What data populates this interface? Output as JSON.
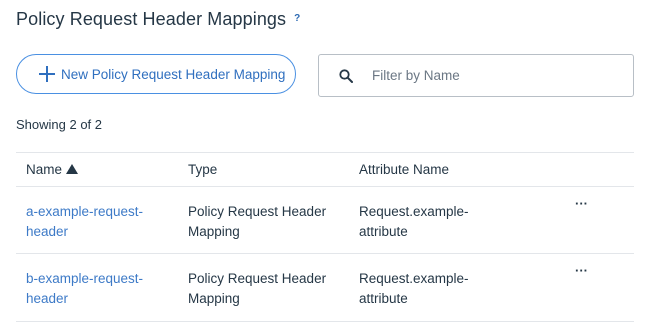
{
  "header": {
    "title": "Policy Request Header Mappings",
    "help": "?"
  },
  "toolbar": {
    "new_button_label": "New Policy Request Header Mapping",
    "filter_placeholder": "Filter by Name",
    "filter_value": ""
  },
  "summary": {
    "showing_text": "Showing 2 of 2"
  },
  "table": {
    "columns": {
      "name": "Name",
      "type": "Type",
      "attribute": "Attribute Name"
    },
    "sort": {
      "column": "Name",
      "direction": "ascending"
    },
    "rows": [
      {
        "name_line1": "a-example-request-",
        "name_line2": "header",
        "type_line1": "Policy Request Header",
        "type_line2": "Mapping",
        "attr_line1": "Request.example-",
        "attr_line2": "attribute",
        "more": "···"
      },
      {
        "name_line1": "b-example-request-",
        "name_line2": "header",
        "type_line1": "Policy Request Header",
        "type_line2": "Mapping",
        "attr_line1": "Request.example-",
        "attr_line2": "attribute",
        "more": "···"
      }
    ]
  },
  "colors": {
    "accent": "#2f6fbf",
    "link": "#3d7ac7",
    "text": "#253746",
    "border": "#e3e6ea"
  },
  "icons": {
    "add": "plus-icon",
    "search": "search-icon",
    "sort": "sort-ascending-icon",
    "more": "more-actions-icon"
  }
}
